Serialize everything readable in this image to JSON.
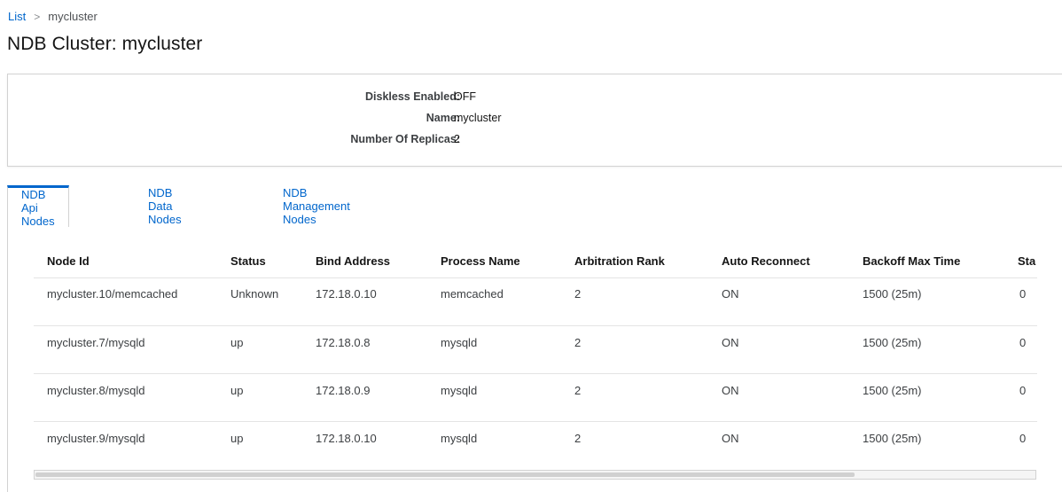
{
  "breadcrumb": {
    "root": "List",
    "separator": ">",
    "current": "mycluster"
  },
  "page_title": "NDB Cluster: mycluster",
  "summary": [
    {
      "label": "Diskless Enabled:",
      "value": "OFF"
    },
    {
      "label": "Name:",
      "value": "mycluster"
    },
    {
      "label": "Number Of Replicas:",
      "value": "2"
    }
  ],
  "tabs": [
    {
      "label": "NDB Api Nodes",
      "active": true
    },
    {
      "label": "NDB Data Nodes",
      "active": false
    },
    {
      "label": "NDB Management Nodes",
      "active": false
    }
  ],
  "table": {
    "columns": [
      "Node Id",
      "Status",
      "Bind Address",
      "Process Name",
      "Arbitration Rank",
      "Auto Reconnect",
      "Backoff Max Time",
      "Sta"
    ],
    "rows": [
      [
        "mycluster.10/memcached",
        "Unknown",
        "172.18.0.10",
        "memcached",
        "2",
        "ON",
        "1500 (25m)",
        "0"
      ],
      [
        "mycluster.7/mysqld",
        "up",
        "172.18.0.8",
        "mysqld",
        "2",
        "ON",
        "1500 (25m)",
        "0"
      ],
      [
        "mycluster.8/mysqld",
        "up",
        "172.18.0.9",
        "mysqld",
        "2",
        "ON",
        "1500 (25m)",
        "0"
      ],
      [
        "mycluster.9/mysqld",
        "up",
        "172.18.0.10",
        "mysqld",
        "2",
        "ON",
        "1500 (25m)",
        "0"
      ]
    ]
  },
  "colors": {
    "link": "#0066cc",
    "border": "#d2d2d2",
    "text": "#151515"
  }
}
